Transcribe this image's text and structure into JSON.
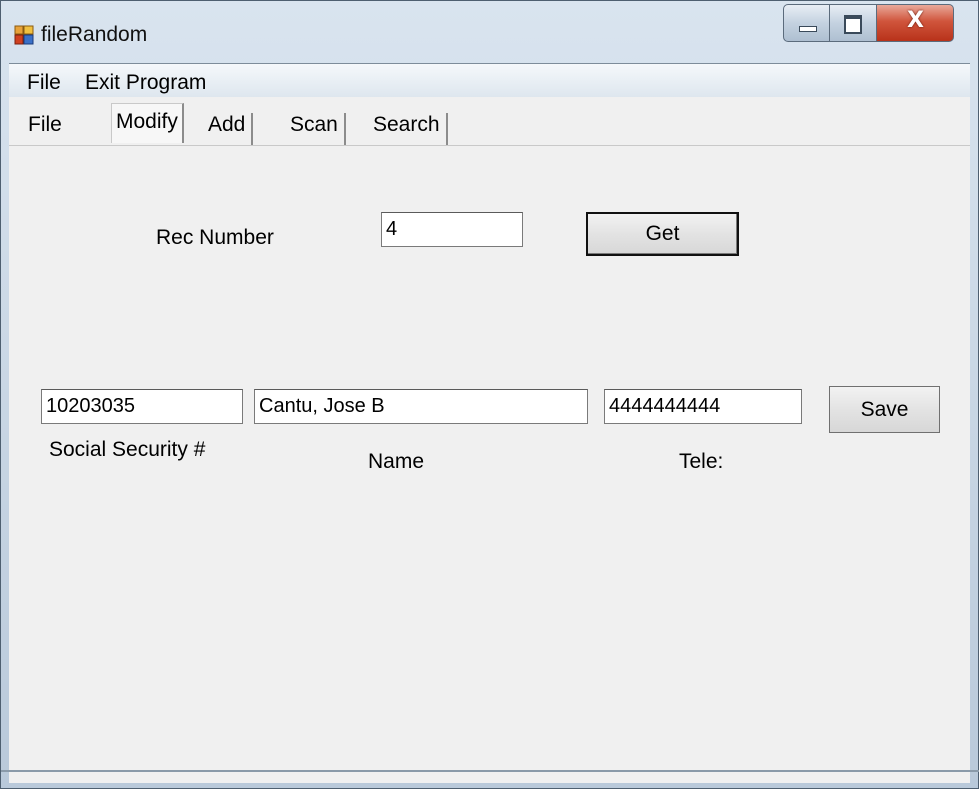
{
  "window": {
    "title": "fileRandom",
    "close_glyph": "X"
  },
  "menubar": {
    "items": [
      "File",
      "Exit Program"
    ]
  },
  "tabs": [
    {
      "label": "File",
      "selected": false
    },
    {
      "label": "Modify",
      "selected": true
    },
    {
      "label": "Add",
      "selected": false
    },
    {
      "label": "Scan",
      "selected": false
    },
    {
      "label": "Search",
      "selected": false
    }
  ],
  "modify": {
    "rec_number_label": "Rec Number",
    "rec_number_value": "4",
    "get_label": "Get",
    "ssn_value": "10203035",
    "name_value": "Cantu, Jose B",
    "tele_value": "4444444444",
    "save_label": "Save",
    "ssn_label": "Social Security #",
    "name_label": "Name",
    "tele_label": "Tele:"
  },
  "icons": {
    "app": "app-icon",
    "minimize": "minimize-icon",
    "maximize": "maximize-icon",
    "close": "close-icon"
  }
}
